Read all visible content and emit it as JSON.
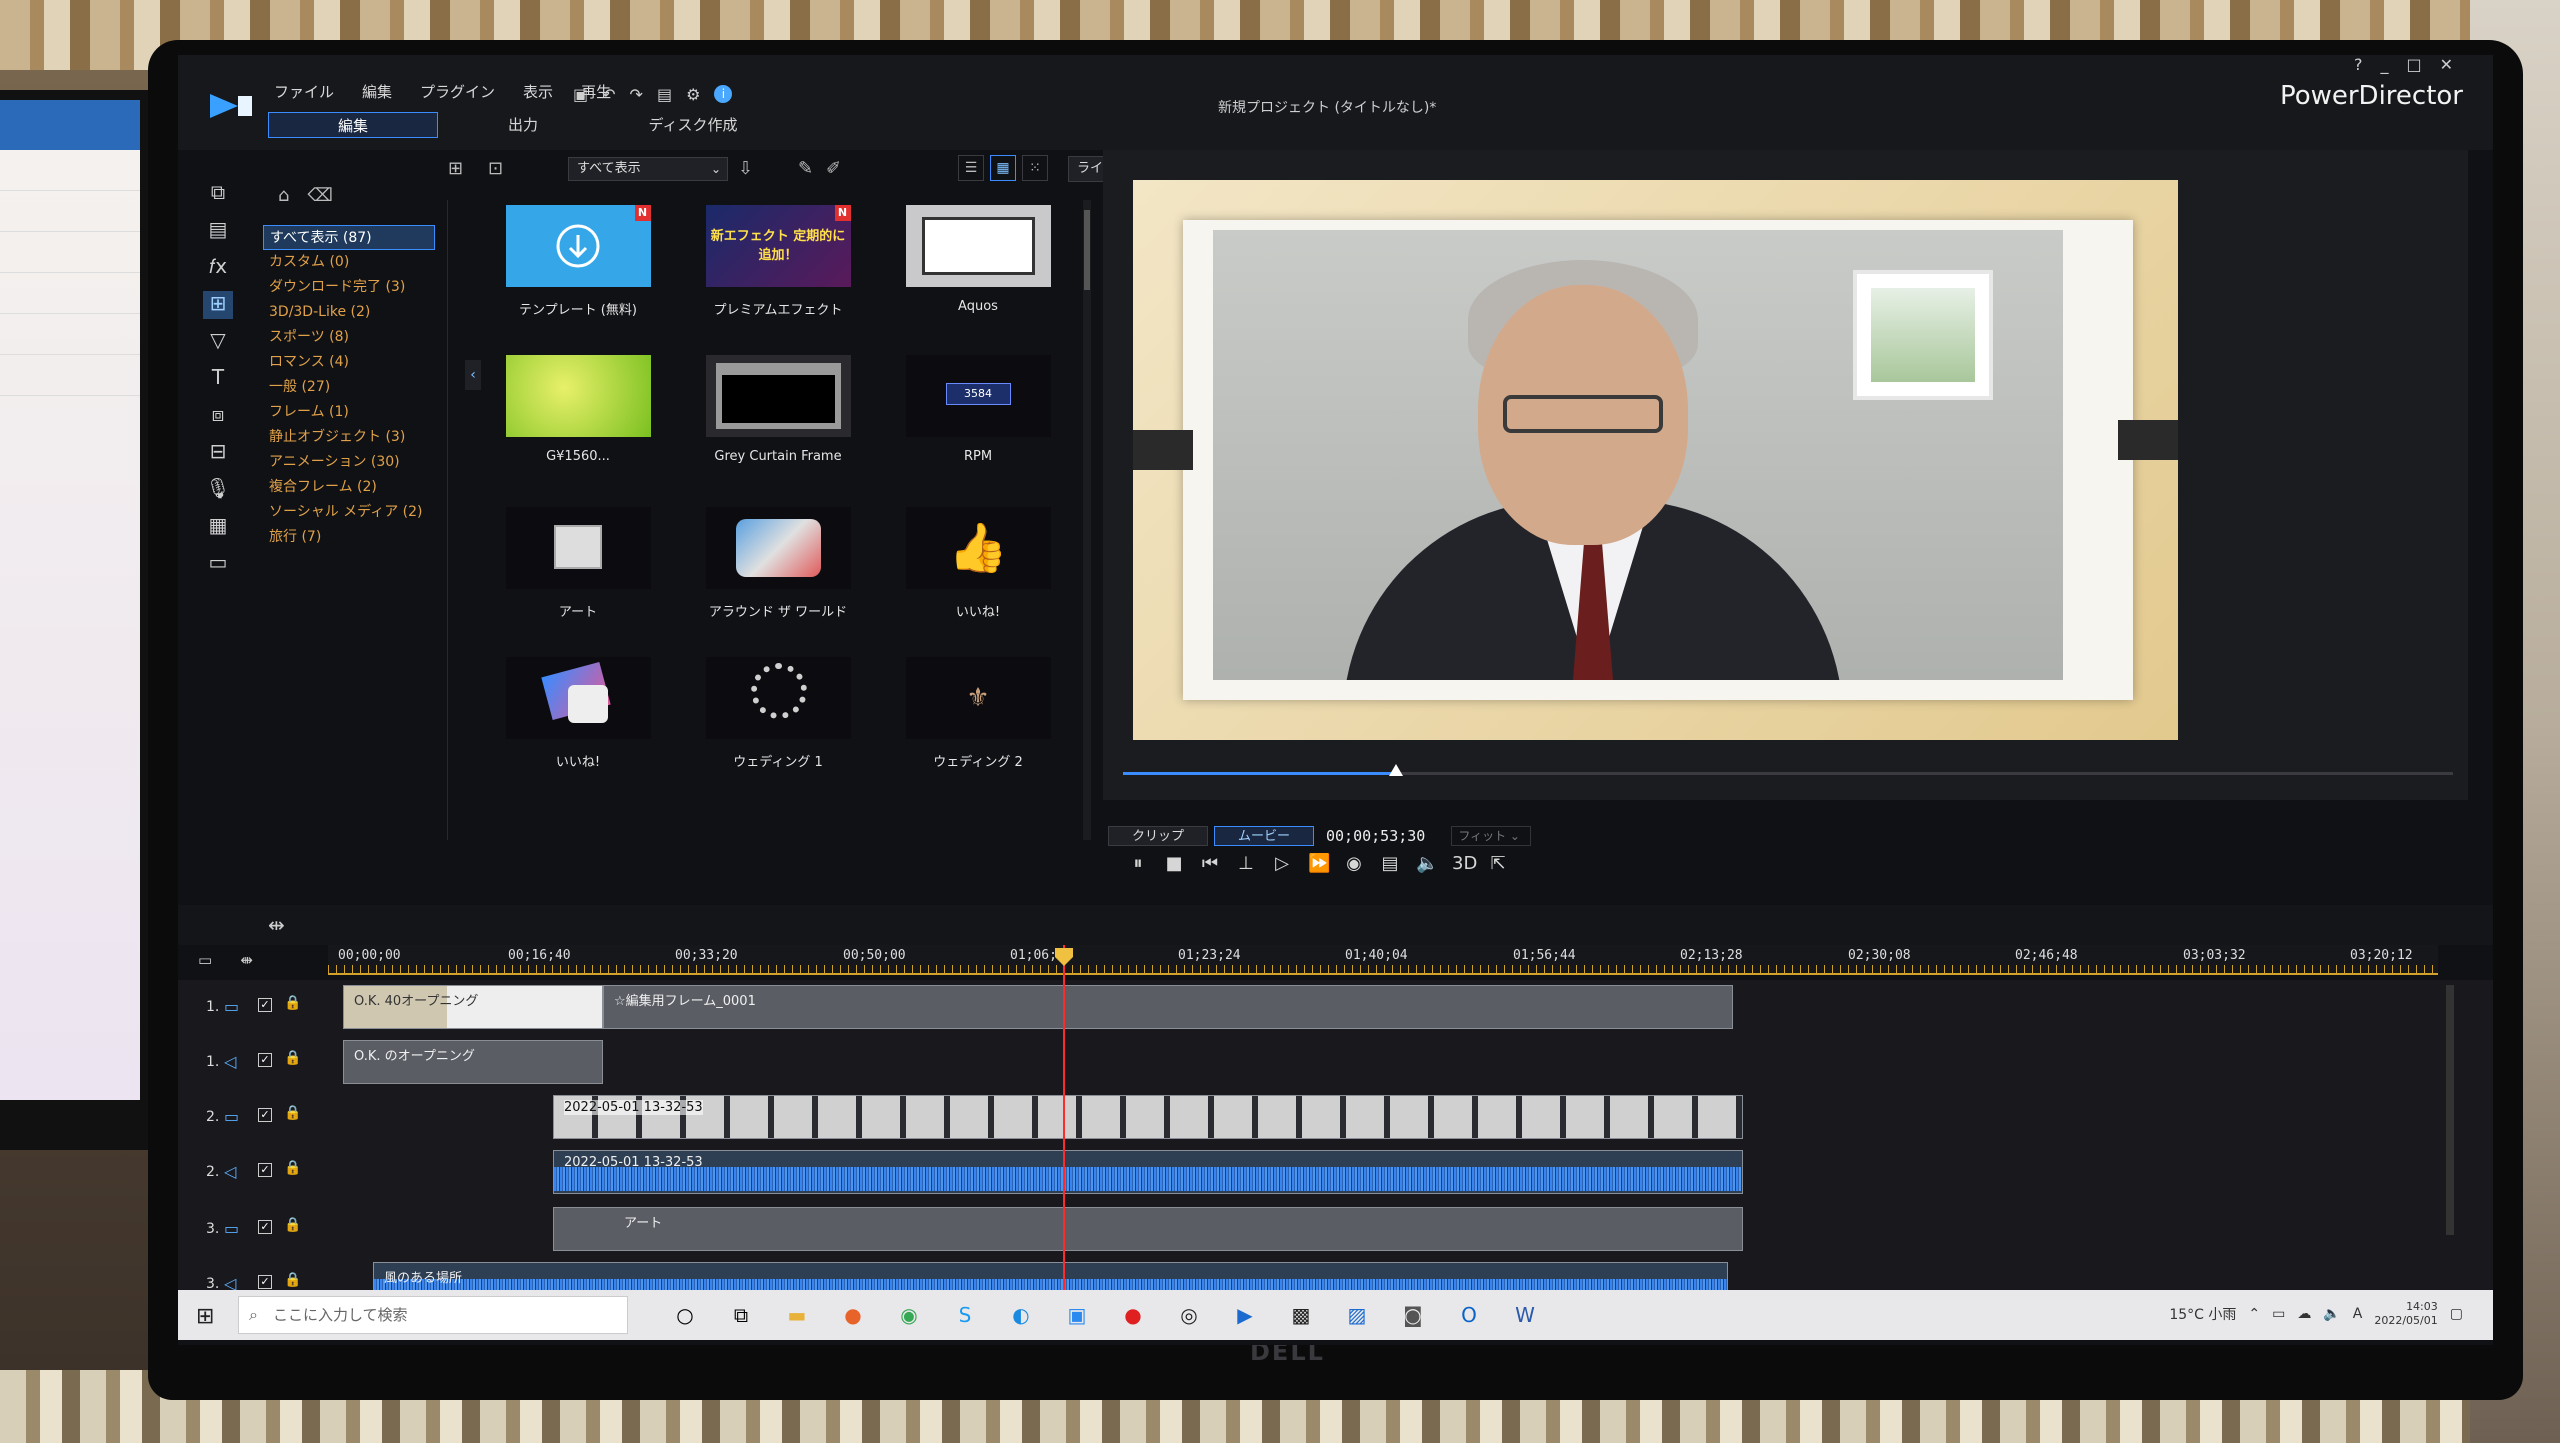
{
  "app": {
    "name": "PowerDirector",
    "project_title": "新規プロジェクト (タイトルなし)*",
    "menu": [
      "ファイル",
      "編集",
      "プラグイン",
      "表示",
      "再生"
    ],
    "mode_tabs": [
      "編集",
      "出力",
      "ディスク作成"
    ],
    "active_mode": "編集",
    "window_controls": [
      "?",
      "_",
      "□",
      "✕"
    ]
  },
  "library": {
    "filter_dropdown": "すべて表示",
    "search_placeholder": "ライブラリーの検索",
    "categories": [
      "すべて表示 (87)",
      "カスタム (0)",
      "ダウンロード完了 (3)",
      "3D/3D-Like (2)",
      "スポーツ (8)",
      "ロマンス (4)",
      "一般 (27)",
      "フレーム (1)",
      "静止オブジェクト (3)",
      "アニメーション (30)",
      "複合フレーム (2)",
      "ソーシャル メディア (2)",
      "旅行 (7)"
    ],
    "tiles": [
      {
        "label": "テンプレート (無料)",
        "badge": "N"
      },
      {
        "label": "プレミアムエフェクト",
        "badge": "N",
        "thumb_text": "新エフェクト 定期的に追加！"
      },
      {
        "label": "Aquos",
        "badge": ""
      },
      {
        "label": "G¥1560...",
        "badge": ""
      },
      {
        "label": "Grey Curtain Frame",
        "badge": ""
      },
      {
        "label": "RPM",
        "badge": "",
        "thumb_text": "3584"
      },
      {
        "label": "アート",
        "badge": ""
      },
      {
        "label": "アラウンド ザ ワールド",
        "badge": ""
      },
      {
        "label": "いいね!",
        "badge": ""
      },
      {
        "label": "いいね!",
        "badge": ""
      },
      {
        "label": "ウェディング 1",
        "badge": ""
      },
      {
        "label": "ウェディング 2",
        "badge": ""
      }
    ]
  },
  "preview": {
    "modes": [
      "クリップ",
      "ムービー"
    ],
    "active_mode": "ムービー",
    "timecode": "00;00;53;30",
    "fit_label": "フィット",
    "scrub_progress": 0.205,
    "stereo_label": "3D"
  },
  "timeline": {
    "ruler_labels": [
      "00;00;00",
      "00;16;40",
      "00;33;20",
      "00;50;00",
      "01;06;44",
      "01;23;24",
      "01;40;04",
      "01;56;44",
      "02;13;28",
      "02;30;08",
      "02;46;48",
      "03;03;32",
      "03;20;12"
    ],
    "tracks": [
      {
        "num": "1.",
        "type": "video",
        "clips": [
          {
            "label": "O.K. 40オープニング"
          },
          {
            "label": "☆編集用フレーム_0001"
          }
        ]
      },
      {
        "num": "1.",
        "type": "audio",
        "clips": [
          {
            "label": "O.K. のオープニング"
          }
        ]
      },
      {
        "num": "2.",
        "type": "video",
        "clips": [
          {
            "label": "2022-05-01 13-32-53"
          }
        ]
      },
      {
        "num": "2.",
        "type": "audio",
        "clips": [
          {
            "label": "2022-05-01 13-32-53"
          }
        ]
      },
      {
        "num": "3.",
        "type": "video",
        "clips": [
          {
            "label": "アート"
          }
        ]
      },
      {
        "num": "3.",
        "type": "audio",
        "clips": [
          {
            "label": "風のある場所"
          }
        ]
      }
    ]
  },
  "taskbar": {
    "search_placeholder": "ここに入力して検索",
    "weather": "15°C 小雨",
    "ime": "A",
    "time": "14:03",
    "date": "2022/05/01"
  },
  "monitor_brand": "DELL",
  "colors": {
    "accent": "#3a8cff",
    "category_text": "#e0a14a",
    "playhead": "#ff2a2a",
    "ruler": "#d1a12a"
  }
}
